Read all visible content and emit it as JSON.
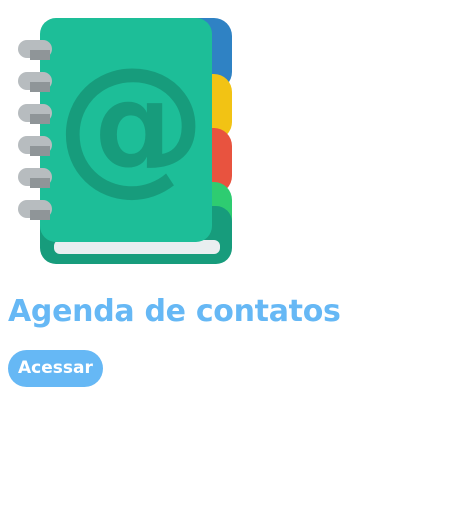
{
  "app": {
    "title": "Agenda de contatos",
    "action_label": "Acessar",
    "icon": "address-book-icon",
    "icon_glyph": "@",
    "colors": {
      "accent": "#66b8f5",
      "cover": "#1dbe98",
      "cover_dark": "#179c7c",
      "tab_blue": "#2f82c4",
      "tab_yellow": "#f2c314",
      "tab_red": "#e8533f",
      "tab_green": "#2ecc71",
      "spiral": "#b7bcbf",
      "pages": "#e9eef0"
    }
  }
}
